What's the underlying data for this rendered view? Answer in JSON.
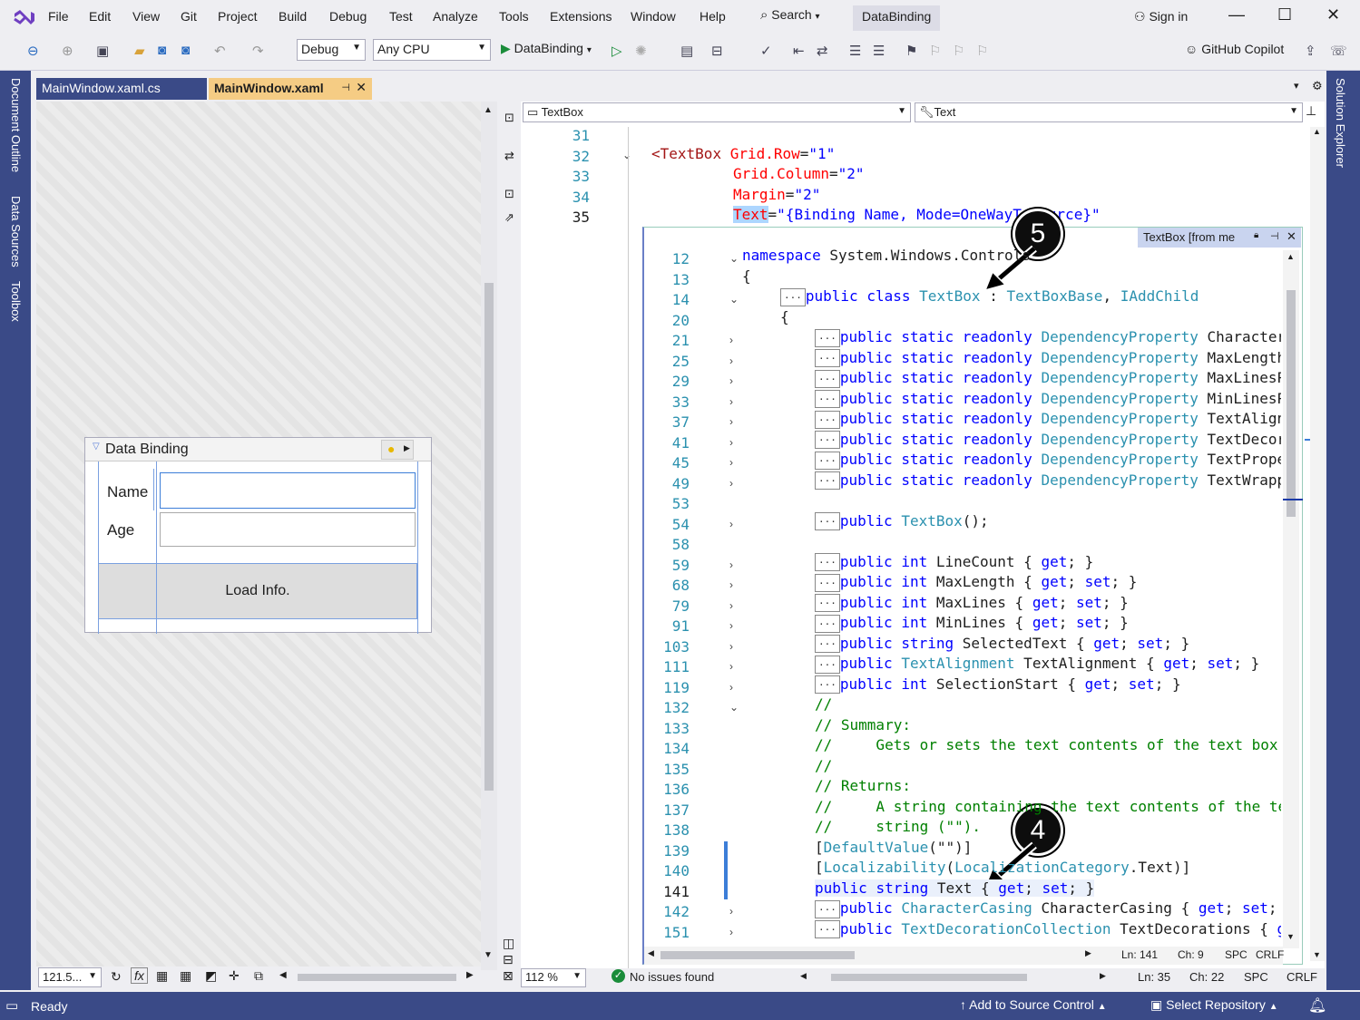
{
  "menu": {
    "items": [
      "File",
      "Edit",
      "View",
      "Git",
      "Project",
      "Build",
      "Debug",
      "Test",
      "Analyze",
      "Tools",
      "Extensions",
      "Window",
      "Help"
    ],
    "search_label": "Search",
    "solution_name": "DataBinding",
    "sign_in": "Sign in"
  },
  "toolbar": {
    "config": "Debug",
    "platform": "Any CPU",
    "run_target": "DataBinding",
    "copilot": "GitHub Copilot"
  },
  "tabs": [
    {
      "label": "MainWindow.xaml.cs",
      "active": false
    },
    {
      "label": "MainWindow.xaml",
      "active": true
    }
  ],
  "side_left": [
    "Document Outline",
    "Data Sources",
    "Toolbox"
  ],
  "side_right": [
    "Solution Explorer"
  ],
  "designer": {
    "window_title": "Data Binding",
    "label_name": "Name",
    "label_age": "Age",
    "button_label": "Load Info.",
    "zoom": "121.5...",
    "fx_label": "fx"
  },
  "editor": {
    "left_combo": "TextBox",
    "right_combo": "Text",
    "zoom": "112 %",
    "issues": "No issues found",
    "status": {
      "ln": "Ln: 35",
      "ch": "Ch: 22",
      "spc": "SPC",
      "crlf": "CRLF"
    },
    "xaml_lines": [
      {
        "num": "31"
      },
      {
        "num": "32"
      },
      {
        "num": "33"
      },
      {
        "num": "34"
      },
      {
        "num": "35"
      }
    ],
    "xaml": {
      "l32_tag": "TextBox",
      "l32_attr": "Grid.Row",
      "l32_val": "\"1\"",
      "l33_attr": "Grid.Column",
      "l33_val": "\"2\"",
      "l34_attr": "Margin",
      "l34_val": "\"2\"",
      "l35_attr": "Text",
      "l35_val": "\"{Binding Name, Mode=OneWayToSource}\""
    }
  },
  "peek": {
    "title": "TextBox [from me",
    "status": {
      "ln": "Ln: 141",
      "ch": "Ch: 9",
      "spc": "SPC",
      "crlf": "CRLF"
    },
    "lines": [
      {
        "num": "12",
        "text": "namespace System.Windows.Controls"
      },
      {
        "num": "13",
        "text": "{"
      },
      {
        "num": "14",
        "text": "public class TextBox : TextBoxBase, IAddChild"
      },
      {
        "num": "20",
        "text": "{"
      },
      {
        "num": "21",
        "text": "public static readonly DependencyProperty CharacterCasingProperty"
      },
      {
        "num": "25",
        "text": "public static readonly DependencyProperty MaxLengthProperty"
      },
      {
        "num": "29",
        "text": "public static readonly DependencyProperty MaxLinesProperty"
      },
      {
        "num": "33",
        "text": "public static readonly DependencyProperty MinLinesProperty"
      },
      {
        "num": "37",
        "text": "public static readonly DependencyProperty TextAlignmentProperty"
      },
      {
        "num": "41",
        "text": "public static readonly DependencyProperty TextDecorationsProperty"
      },
      {
        "num": "45",
        "text": "public static readonly DependencyProperty TextProperty"
      },
      {
        "num": "49",
        "text": "public static readonly DependencyProperty TextWrappingProperty"
      },
      {
        "num": "53",
        "text": ""
      },
      {
        "num": "54",
        "text": "public TextBox();"
      },
      {
        "num": "58",
        "text": ""
      },
      {
        "num": "59",
        "text": "public int LineCount { get; }"
      },
      {
        "num": "68",
        "text": "public int MaxLength { get; set; }"
      },
      {
        "num": "79",
        "text": "public int MaxLines { get; set; }"
      },
      {
        "num": "91",
        "text": "public int MinLines { get; set; }"
      },
      {
        "num": "103",
        "text": "public string SelectedText { get; set; }"
      },
      {
        "num": "111",
        "text": "public TextAlignment TextAlignment { get; set; }"
      },
      {
        "num": "119",
        "text": "public int SelectionStart { get; set; }"
      },
      {
        "num": "132",
        "text": "//"
      },
      {
        "num": "133",
        "text": "// Summary:"
      },
      {
        "num": "134",
        "text": "//     Gets or sets the text contents of the text box."
      },
      {
        "num": "135",
        "text": "//"
      },
      {
        "num": "136",
        "text": "// Returns:"
      },
      {
        "num": "137",
        "text": "//     A string containing the text contents of the text box. The default is an empty"
      },
      {
        "num": "138",
        "text": "//     string (\"\")."
      },
      {
        "num": "139",
        "text": "[DefaultValue(\"\")]"
      },
      {
        "num": "140",
        "text": "[Localizability(LocalizationCategory.Text)]"
      },
      {
        "num": "141",
        "text": "public string Text { get; set; }"
      },
      {
        "num": "142",
        "text": "public CharacterCasing CharacterCasing { get; set; }"
      },
      {
        "num": "151",
        "text": "public TextDecorationCollection TextDecorations { get; set; }"
      }
    ]
  },
  "callouts": {
    "top": "5",
    "bottom": "4"
  },
  "statusbar": {
    "ready": "Ready",
    "source_control": "Add to Source Control",
    "repository": "Select Repository"
  },
  "colors": {
    "accent": "#3a4a87",
    "active_tab": "#f5cc84",
    "keyword": "#0000ff",
    "type": "#2b91af",
    "comment": "#008000",
    "xaml_attr": "#ff0000"
  }
}
